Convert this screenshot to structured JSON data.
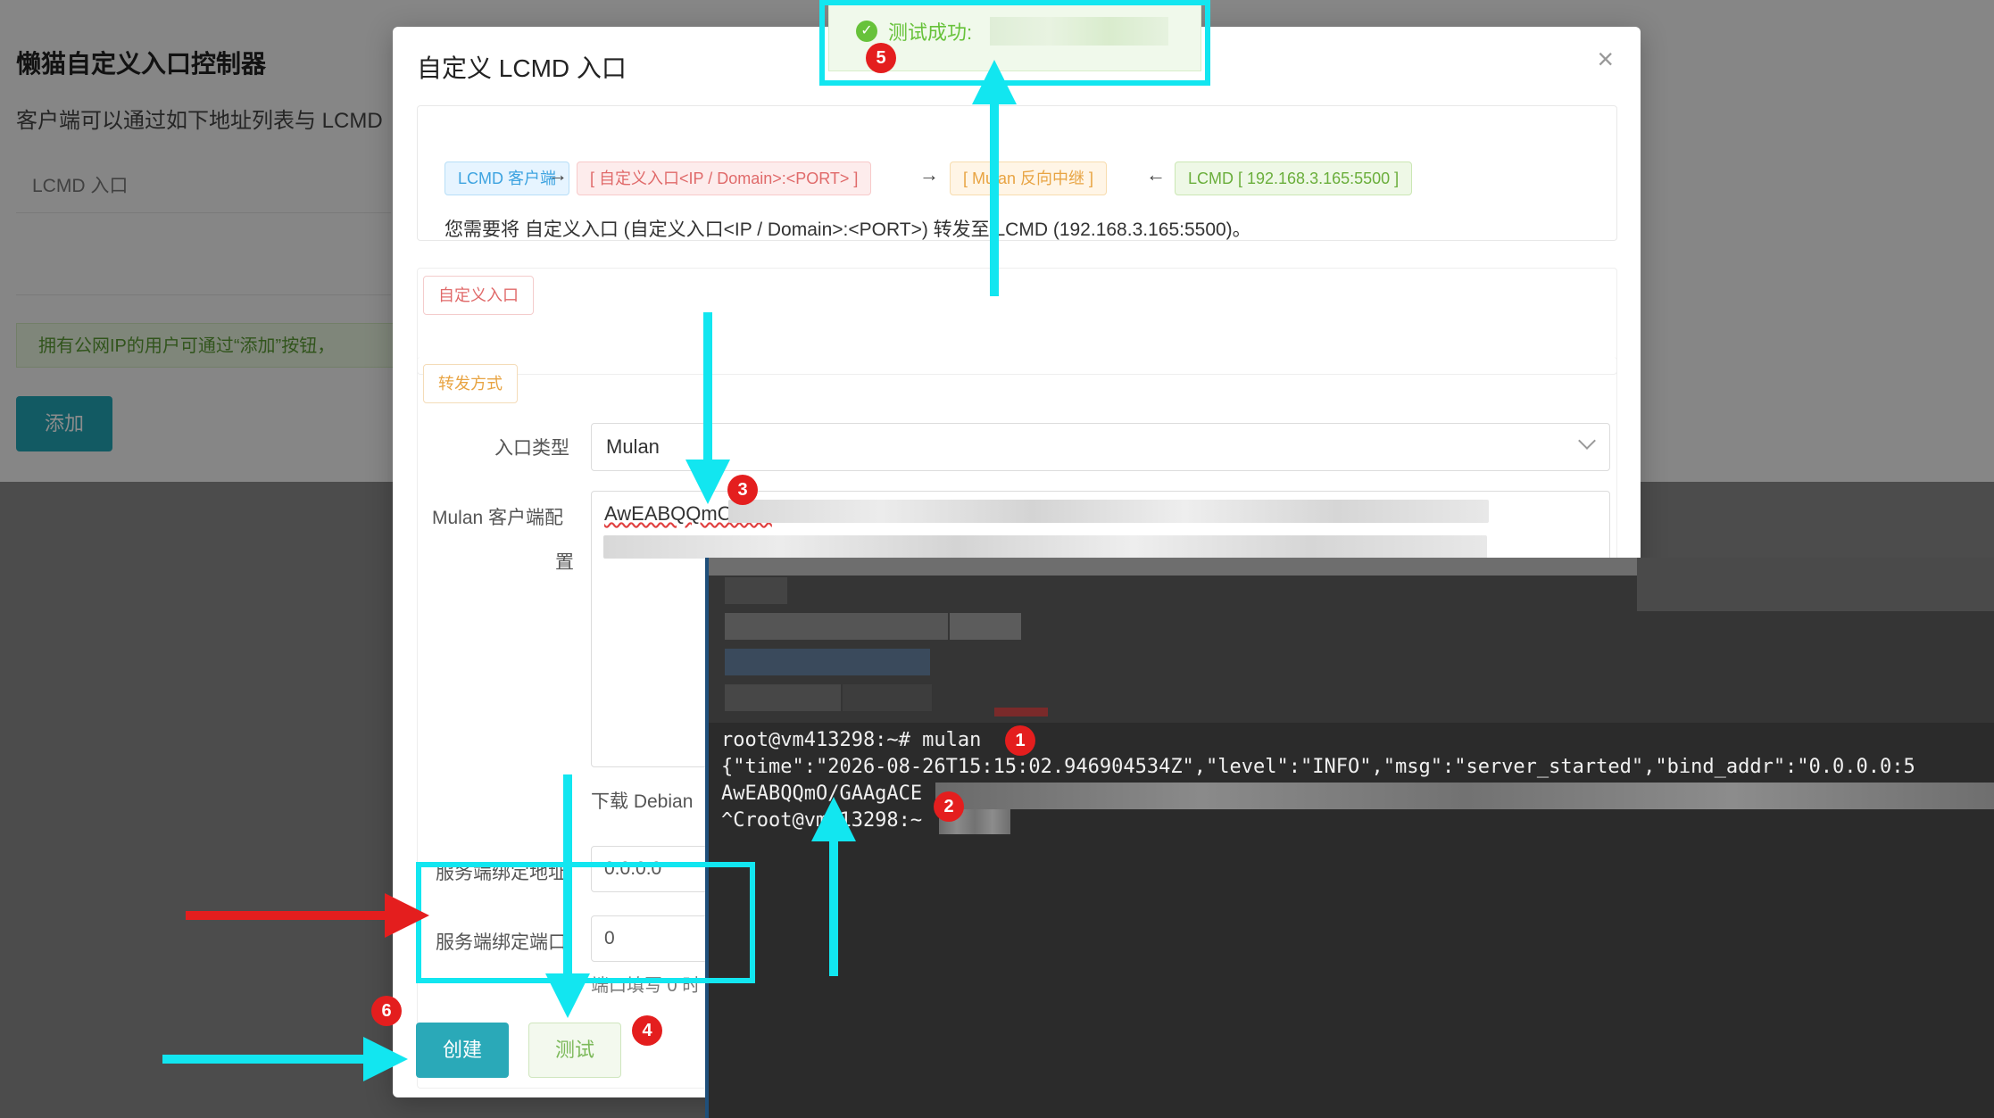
{
  "background": {
    "title": "懒猫自定义入口控制器",
    "description": "客户端可以通过如下地址列表与 LCMD",
    "column_header": "LCMD 入口",
    "alert": "拥有公网IP的用户可通过“添加”按钮，",
    "add_button": "添加"
  },
  "modal": {
    "title": "自定义 LCMD 入口",
    "close_icon": "close-icon",
    "flow": {
      "client": "LCMD 客户端",
      "custom_entry": "[ 自定义入口<IP / Domain>:<PORT> ]",
      "relay": "[ Mulan 反向中继 ]",
      "lcmd": "LCMD [ 192.168.3.165:5500 ]",
      "description": "您需要将 自定义入口 (自定义入口<IP / Domain>:<PORT>) 转发至 LCMD (192.168.3.165:5500)。"
    },
    "section_custom_entry": "自定义入口",
    "section_forward_method": "转发方式",
    "entry_type_label": "入口类型",
    "entry_type_value": "Mulan",
    "client_config_label_1": "Mulan 客户端配",
    "client_config_label_2": "置",
    "client_config_value": "AwEABQQmO/GA/",
    "download_text": "下载 Debian",
    "bind_addr_label": "服务端绑定地址",
    "bind_addr_value": "0.0.0.0",
    "bind_port_label": "服务端绑定端口",
    "bind_port_value": "0",
    "port_hint": "端口填写 0 时",
    "create_button": "创建",
    "test_button": "测试"
  },
  "toast": {
    "icon": "check-circle-icon",
    "text": "测试成功:"
  },
  "terminal": {
    "line1": "root@vm413298:~# mulan",
    "line2": "{\"time\":\"2026-08-26T15:15:02.946904534Z\",\"level\":\"INFO\",\"msg\":\"server_started\",\"bind_addr\":\"0.0.0.0:5",
    "line3": "AwEABQQmO/GAAgACE",
    "line4": "^Croot@vm413298:~"
  },
  "annotations": {
    "badge_1": "1",
    "badge_2": "2",
    "badge_3": "3",
    "badge_4": "4",
    "badge_5": "5",
    "badge_6": "6",
    "highlight_color": "#12e6f0",
    "badge_color": "#e41e1e",
    "pointer_color": "#e41e1e"
  }
}
